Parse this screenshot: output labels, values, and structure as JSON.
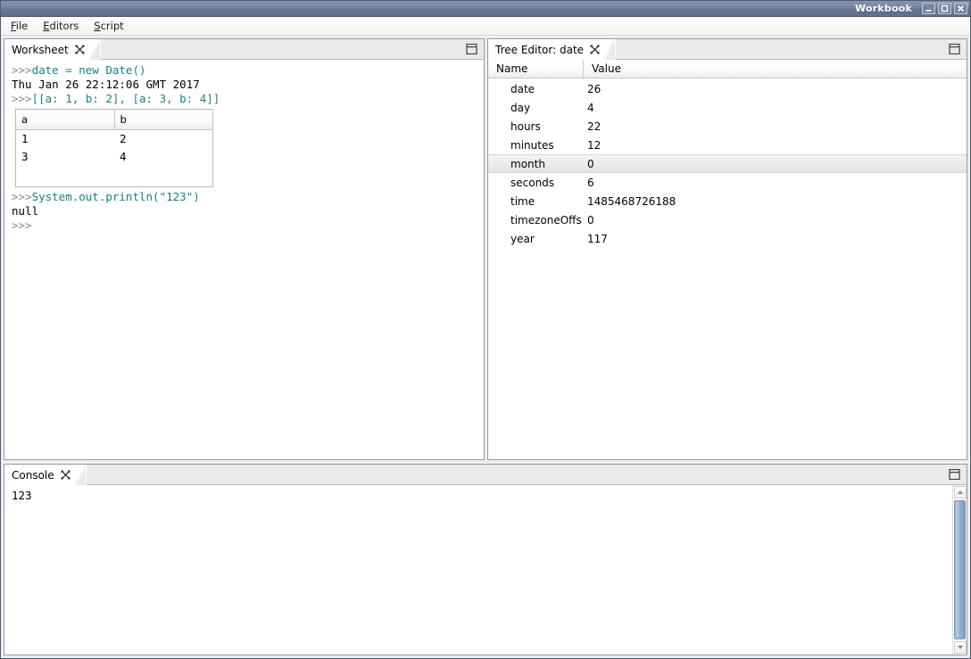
{
  "window": {
    "title": "Workbook",
    "buttons": [
      {
        "name": "minimize-button",
        "glyph": "–"
      },
      {
        "name": "maximize-button",
        "glyph": "□"
      },
      {
        "name": "close-button",
        "glyph": "✖"
      }
    ]
  },
  "menubar": {
    "items": [
      {
        "mnemonic": "F",
        "rest": "ile"
      },
      {
        "mnemonic": "E",
        "rest": "ditors"
      },
      {
        "mnemonic": "S",
        "rest": "cript"
      }
    ]
  },
  "worksheet": {
    "tab_label": "Worksheet",
    "close_icon": "close-icon",
    "maximize_icon": "maximize-icon",
    "lines": [
      {
        "prompt": ">>>",
        "code": "date = new Date()"
      },
      {
        "output": "Thu Jan 26 22:12:06 GMT 2017"
      },
      {
        "prompt": ">>>",
        "code": "[[a: 1, b: 2], [a: 3, b: 4]]"
      }
    ],
    "result_table": {
      "headers": [
        "a",
        "b"
      ],
      "rows": [
        [
          "1",
          "2"
        ],
        [
          "3",
          "4"
        ]
      ]
    },
    "lines_after": [
      {
        "prompt": ">>>",
        "code": "System.out.println(\"123\")"
      },
      {
        "output": "null"
      },
      {
        "prompt": ">>>",
        "code": ""
      }
    ]
  },
  "tree_editor": {
    "tab_label": "Tree Editor: date",
    "close_icon": "close-icon",
    "maximize_icon": "maximize-icon",
    "columns": [
      "Name",
      "Value"
    ],
    "rows": [
      {
        "name": "date",
        "value": "26",
        "selected": false
      },
      {
        "name": "day",
        "value": "4",
        "selected": false
      },
      {
        "name": "hours",
        "value": "22",
        "selected": false
      },
      {
        "name": "minutes",
        "value": "12",
        "selected": false
      },
      {
        "name": "month",
        "value": "0",
        "selected": true
      },
      {
        "name": "seconds",
        "value": "6",
        "selected": false
      },
      {
        "name": "time",
        "value": "1485468726188",
        "selected": false
      },
      {
        "name": "timezoneOffs",
        "value": "0",
        "selected": false
      },
      {
        "name": "year",
        "value": "117",
        "selected": false
      }
    ]
  },
  "console": {
    "tab_label": "Console",
    "close_icon": "close-icon",
    "maximize_icon": "maximize-icon",
    "text": "123",
    "scrollbar": {
      "up_icon": "arrow-up-icon",
      "down_icon": "arrow-down-icon"
    }
  },
  "colors": {
    "titlebar_start": "#8494ad",
    "titlebar_end": "#5e708c",
    "code_text": "#1a7f86",
    "prompt_text": "#8a8a8a",
    "scrollbar_thumb": "#93aece",
    "selection_row": "#ececec"
  }
}
